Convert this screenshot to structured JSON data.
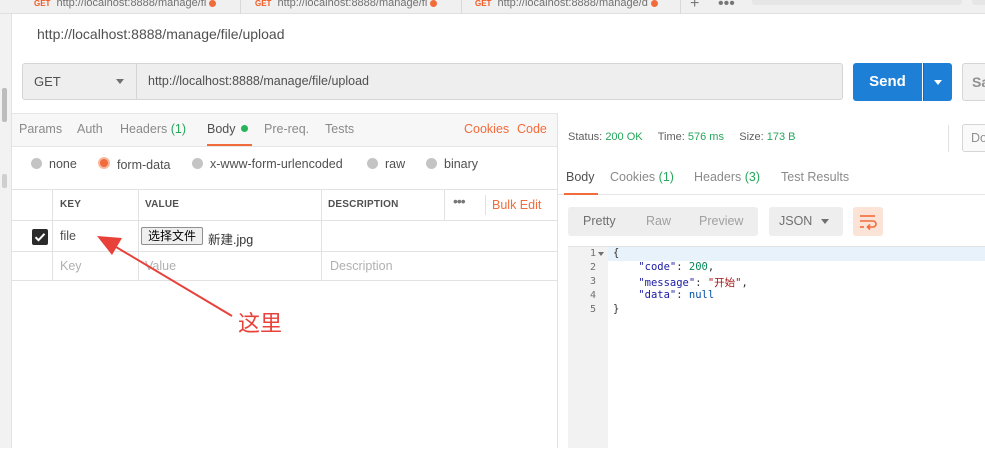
{
  "tabs": [
    {
      "method": "GET",
      "url": "http://localhost:8888/manage/fi"
    },
    {
      "method": "GET",
      "url": "http://localhost:8888/manage/fi"
    },
    {
      "method": "GET",
      "url": "http://localhost:8888/manage/d"
    }
  ],
  "request": {
    "title": "http://localhost:8888/manage/file/upload",
    "method": "GET",
    "url": "http://localhost:8888/manage/file/upload",
    "send_label": "Send",
    "save_label": "Sa"
  },
  "request_tabs": {
    "params": "Params",
    "auth": "Auth",
    "headers": "Headers",
    "headers_count": "(1)",
    "body": "Body",
    "prereq": "Pre-req.",
    "tests": "Tests",
    "cookies": "Cookies",
    "code": "Code"
  },
  "body_types": [
    "none",
    "form-data",
    "x-www-form-urlencoded",
    "raw",
    "binary"
  ],
  "kv_table": {
    "headers": {
      "key": "KEY",
      "value": "VALUE",
      "description": "DESCRIPTION"
    },
    "bulk_edit": "Bulk Edit",
    "rows": [
      {
        "key": "file",
        "file_button": "选择文件",
        "file_name": "新建.jpg",
        "checked": true
      }
    ],
    "placeholder": {
      "key": "Key",
      "value": "Value",
      "description": "Description"
    }
  },
  "annotation": "这里",
  "response": {
    "status_label": "Status:",
    "status": "200 OK",
    "time_label": "Time:",
    "time": "576 ms",
    "size_label": "Size:",
    "size": "173 B",
    "download_label": "Do",
    "tabs": {
      "body": "Body",
      "cookies": "Cookies",
      "cookies_count": "(1)",
      "headers": "Headers",
      "headers_count": "(3)",
      "test_results": "Test Results"
    },
    "view_tabs": [
      "Pretty",
      "Raw",
      "Preview"
    ],
    "format": "JSON",
    "line_numbers": [
      "1",
      "2",
      "3",
      "4",
      "5"
    ],
    "code": {
      "open": "{",
      "code_key": "\"code\"",
      "code_val": "200",
      "message_key": "\"message\"",
      "message_val": "\"开始\"",
      "data_key": "\"data\"",
      "data_val": "null",
      "close": "}"
    }
  },
  "colors": {
    "accent": "#f26b3a",
    "send": "#1e7fd6",
    "ok": "#26a65b",
    "annotation": "#e8413a"
  }
}
